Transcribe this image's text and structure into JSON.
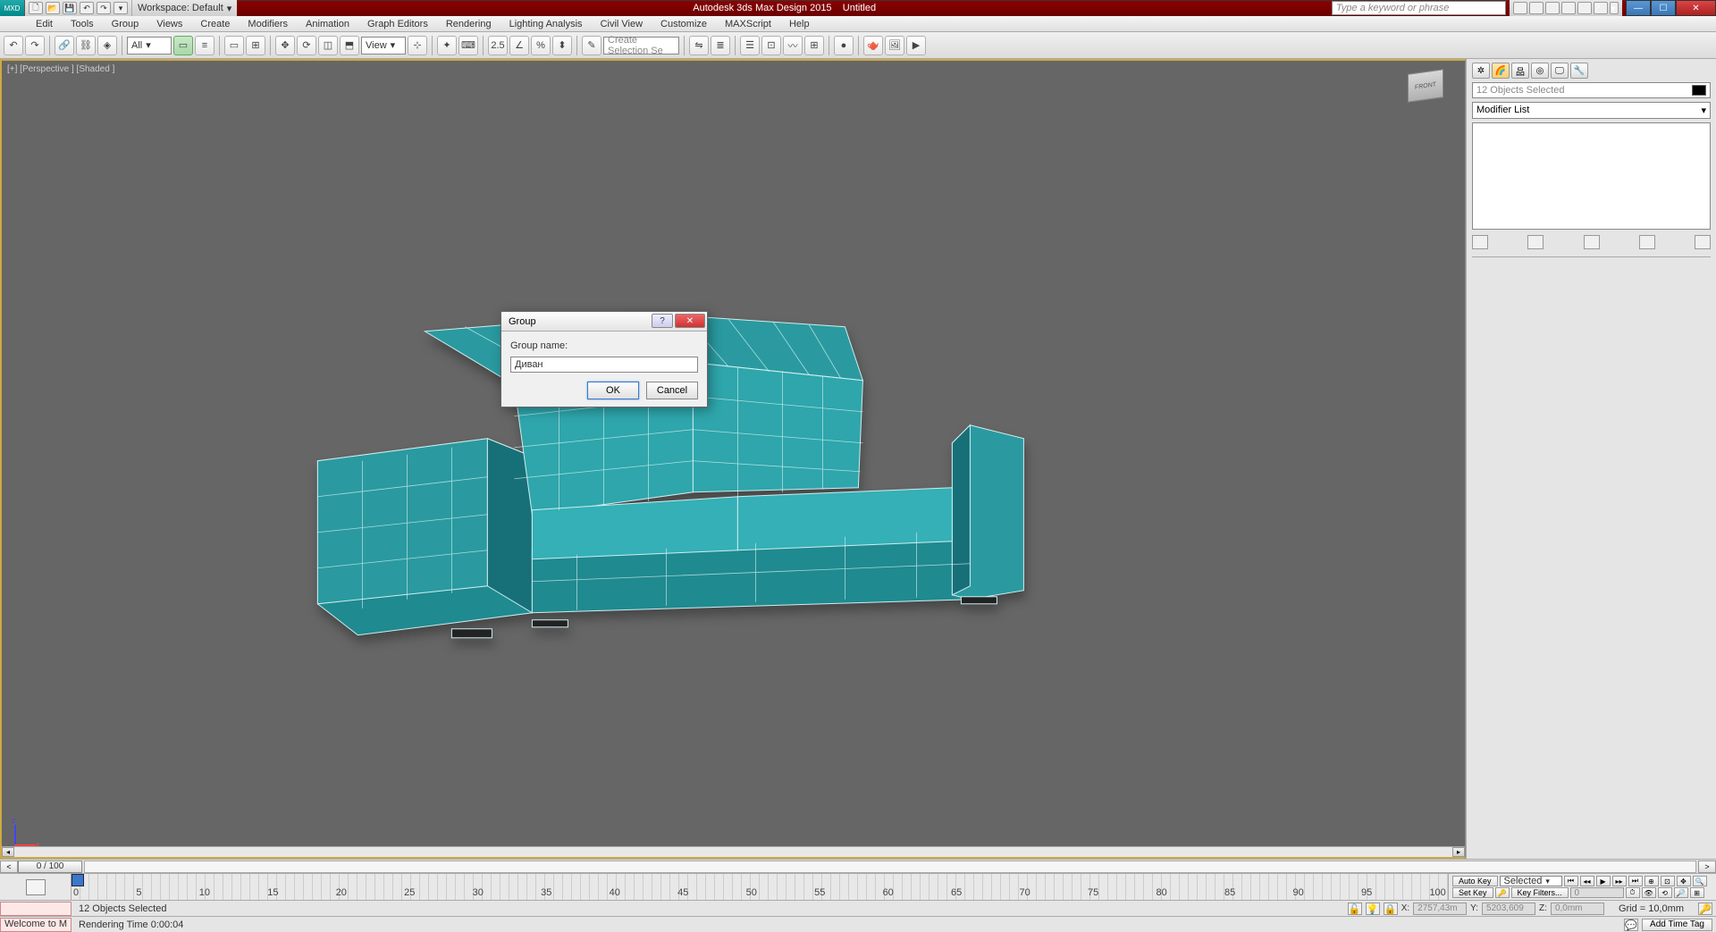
{
  "title": {
    "app": "Autodesk 3ds Max Design 2015",
    "doc": "Untitled"
  },
  "search_placeholder": "Type a keyword or phrase",
  "workspace": {
    "label": "Workspace: Default"
  },
  "menus": [
    "Edit",
    "Tools",
    "Group",
    "Views",
    "Create",
    "Modifiers",
    "Animation",
    "Graph Editors",
    "Rendering",
    "Lighting Analysis",
    "Civil View",
    "Customize",
    "MAXScript",
    "Help"
  ],
  "toolbar": {
    "filter_all": "All",
    "view_label": "View",
    "create_sel": "Create Selection Se"
  },
  "viewport": {
    "label": "[+] [Perspective ] [Shaded ]",
    "axis_x": "x",
    "axis_z": "z",
    "cube": "FRONT"
  },
  "cmdpanel": {
    "selected": "12 Objects Selected",
    "modlist": "Modifier List"
  },
  "dialog": {
    "title": "Group",
    "label": "Group name:",
    "value": "Диван",
    "ok": "OK",
    "cancel": "Cancel"
  },
  "timeslider": {
    "frame": "0 / 100"
  },
  "ruler": {
    "ticks": [
      "0",
      "5",
      "10",
      "15",
      "20",
      "25",
      "30",
      "35",
      "40",
      "45",
      "50",
      "55",
      "60",
      "65",
      "70",
      "75",
      "80",
      "85",
      "90",
      "95",
      "100"
    ]
  },
  "anim": {
    "autokey": "Auto Key",
    "setkey": "Set Key",
    "selected": "Selected",
    "keyfilters": "Key Filters..."
  },
  "status": {
    "script": "Welcome to M",
    "selected": "12 Objects Selected",
    "rendertime": "Rendering Time  0:00:04",
    "x": "2757,43m",
    "y": "5203,609",
    "z": "0,0mm",
    "grid": "Grid = 10,0mm",
    "addtag": "Add Time Tag"
  }
}
